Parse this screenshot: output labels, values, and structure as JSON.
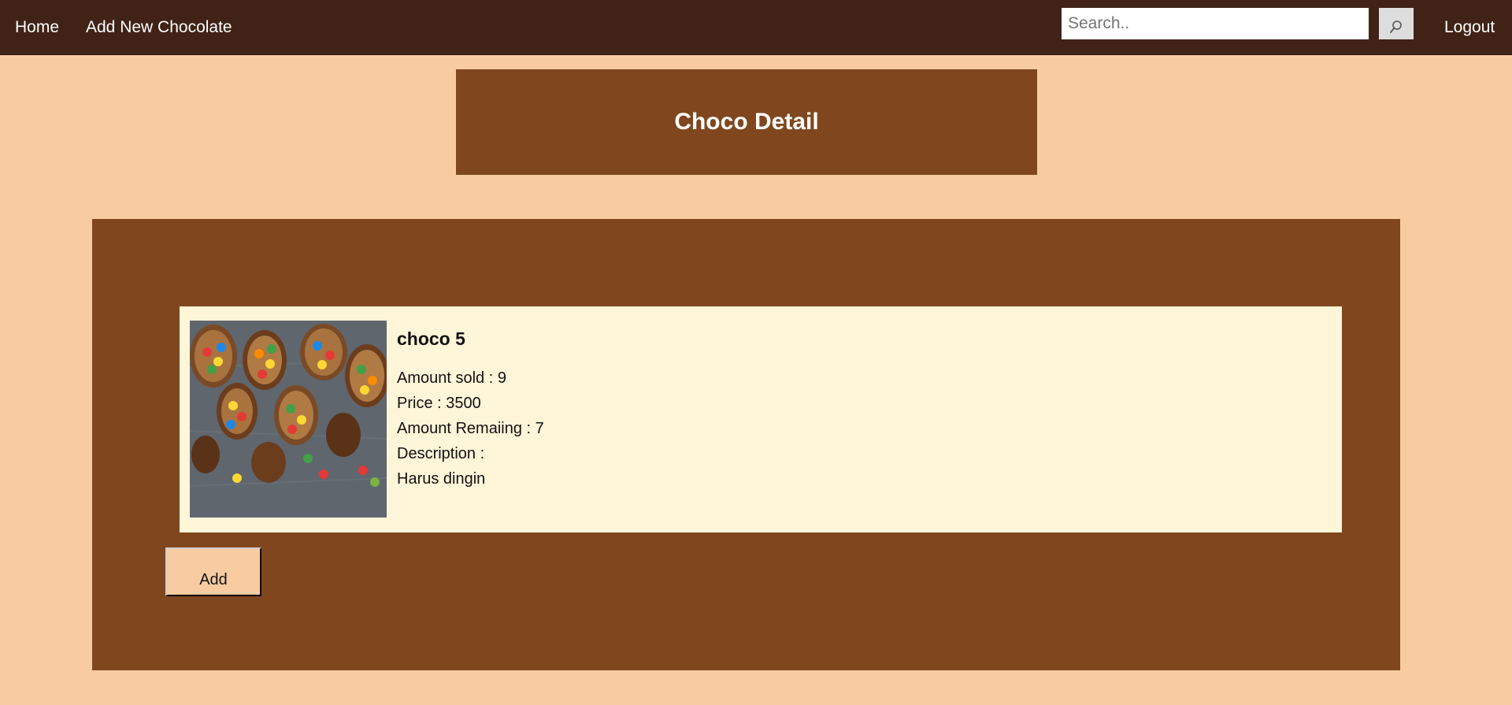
{
  "nav": {
    "home_label": "Home",
    "add_label": "Add New Chocolate",
    "logout_label": "Logout",
    "search_placeholder": "Search..",
    "search_value": "",
    "search_icon": "search-icon"
  },
  "header": {
    "title": "Choco Detail"
  },
  "product": {
    "name": "choco 5",
    "amount_sold": "Amount sold : 9",
    "price": "Price : 3500",
    "amount_remaining": "Amount Remaiing : 7",
    "description_label": "Description :",
    "description": "Harus dingin",
    "image": "chocolate-eggs-with-candies"
  },
  "actions": {
    "add_label": "Add"
  },
  "colors": {
    "navbar": "#402316",
    "page_background": "#f8cba1",
    "panel": "#80471e",
    "card": "#fff5d9"
  }
}
